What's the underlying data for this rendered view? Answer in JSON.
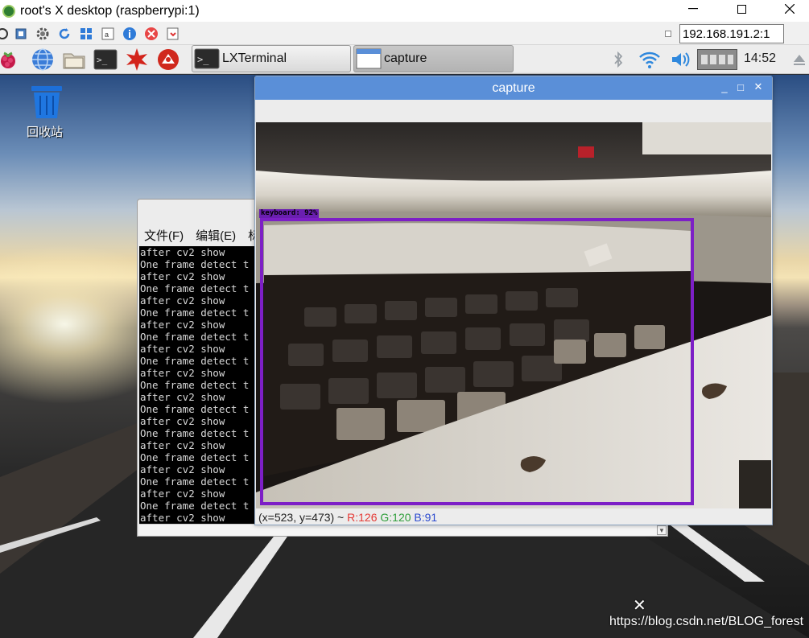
{
  "host_window": {
    "title": "root's X desktop (raspberrypi:1)",
    "controls": [
      "—",
      "",
      "✕"
    ]
  },
  "vnc_toolbar": {
    "address": "192.168.191.2:1",
    "icons": [
      "options-icon",
      "fullscreen-icon",
      "settings-icon",
      "refresh-icon",
      "windows-key-icon",
      "ctrl-alt-del-icon",
      "info-icon",
      "disconnect-icon",
      "transfer-icon"
    ]
  },
  "panel": {
    "taskbar": [
      {
        "label": "LXTerminal",
        "active": false
      },
      {
        "label": "capture",
        "active": true
      }
    ],
    "clock": "14:52"
  },
  "desktop": {
    "trash_label": "回收站"
  },
  "terminal": {
    "menu": [
      "文件(F)",
      "编辑(E)",
      "标"
    ],
    "lines": [
      "after cv2 show",
      "One frame detect t",
      "after cv2 show",
      "One frame detect t",
      "after cv2 show",
      "One frame detect t",
      "after cv2 show",
      "One frame detect t",
      "after cv2 show",
      "One frame detect t",
      "after cv2 show",
      "One frame detect t",
      "after cv2 show",
      "One frame detect t",
      "after cv2 show",
      "One frame detect t",
      "after cv2 show",
      "One frame detect t",
      "after cv2 show",
      "One frame detect t",
      "after cv2 show",
      "One frame detect t",
      "after cv2 show"
    ]
  },
  "capture": {
    "title": "capture",
    "controls": [
      "_",
      "□",
      "✕"
    ],
    "detection_label": "keyboard: 92%",
    "status_prefix": "(x=523, y=473) ~ ",
    "status_r": "R:126",
    "status_g": "G:120",
    "status_b": "B:91"
  },
  "watermark": "https://blog.csdn.net/BLOG_forest",
  "colors": {
    "detection_box": "#7d1fc6",
    "capture_titlebar": "#5a8fd8",
    "panel_bg": "#ededed"
  }
}
